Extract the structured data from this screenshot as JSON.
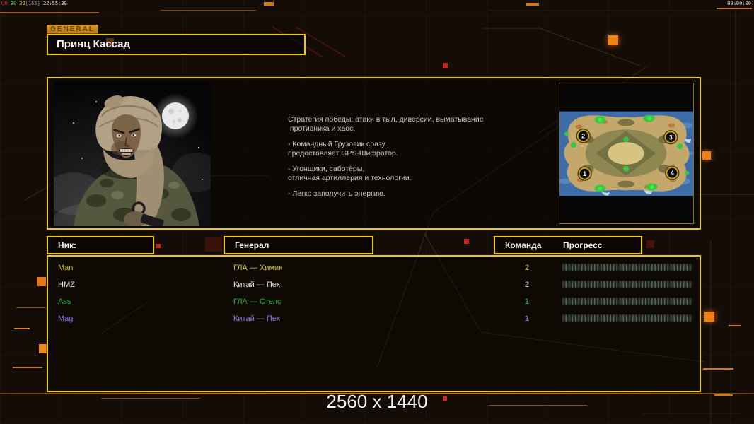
{
  "overlay": {
    "stats_segments": [
      {
        "text": "UR",
        "color": "#d63226"
      },
      {
        "text": " 30",
        "color": "#52c23a"
      },
      {
        "text": " 32",
        "color": "#d8c322"
      },
      {
        "text": "[165]",
        "color": "#8f8f8f"
      },
      {
        "text": " 22:55:39",
        "color": "#e4dcd2"
      }
    ],
    "clock": "00:00:00"
  },
  "header": {
    "tab_label": "GENERAL",
    "general_name": "Принц Кассад"
  },
  "bio": {
    "lines": [
      "Стратегия победы: атаки в тыл, диверсии, выматывание",
      " противника и хаос.",
      "",
      "- Командный Грузовик сразу",
      "предоставляет GPS-Шифратор.",
      "",
      "- Угонщики, саботёры,",
      "отличная артиллерия и технологии.",
      "",
      "- Легко заполучить энергию."
    ]
  },
  "map_preview": {
    "markers": [
      "1",
      "2",
      "3",
      "4"
    ]
  },
  "table": {
    "headers": {
      "nick": "Ник:",
      "general": "Генерал",
      "team": "Команда",
      "progress": "Прогресс"
    },
    "rows": [
      {
        "nick": "Man",
        "general": "ГЛА — Химик",
        "team": "2",
        "color": "#d6c31c"
      },
      {
        "nick": "HMZ",
        "general": "Китай — Пех",
        "team": "2",
        "color": "#e8e8e8"
      },
      {
        "nick": "Ass",
        "general": "ГЛА — Стелс",
        "team": "1",
        "color": "#2db42d"
      },
      {
        "nick": "Mag",
        "general": "Китай — Пех",
        "team": "1",
        "color": "#8a7ae6"
      }
    ]
  },
  "footer": {
    "resolution": "2560 x 1440"
  },
  "colors": {
    "panel_border": "#e0ca25",
    "accent_orange": "#cf7518",
    "marker_ring": "#c9a41f"
  }
}
